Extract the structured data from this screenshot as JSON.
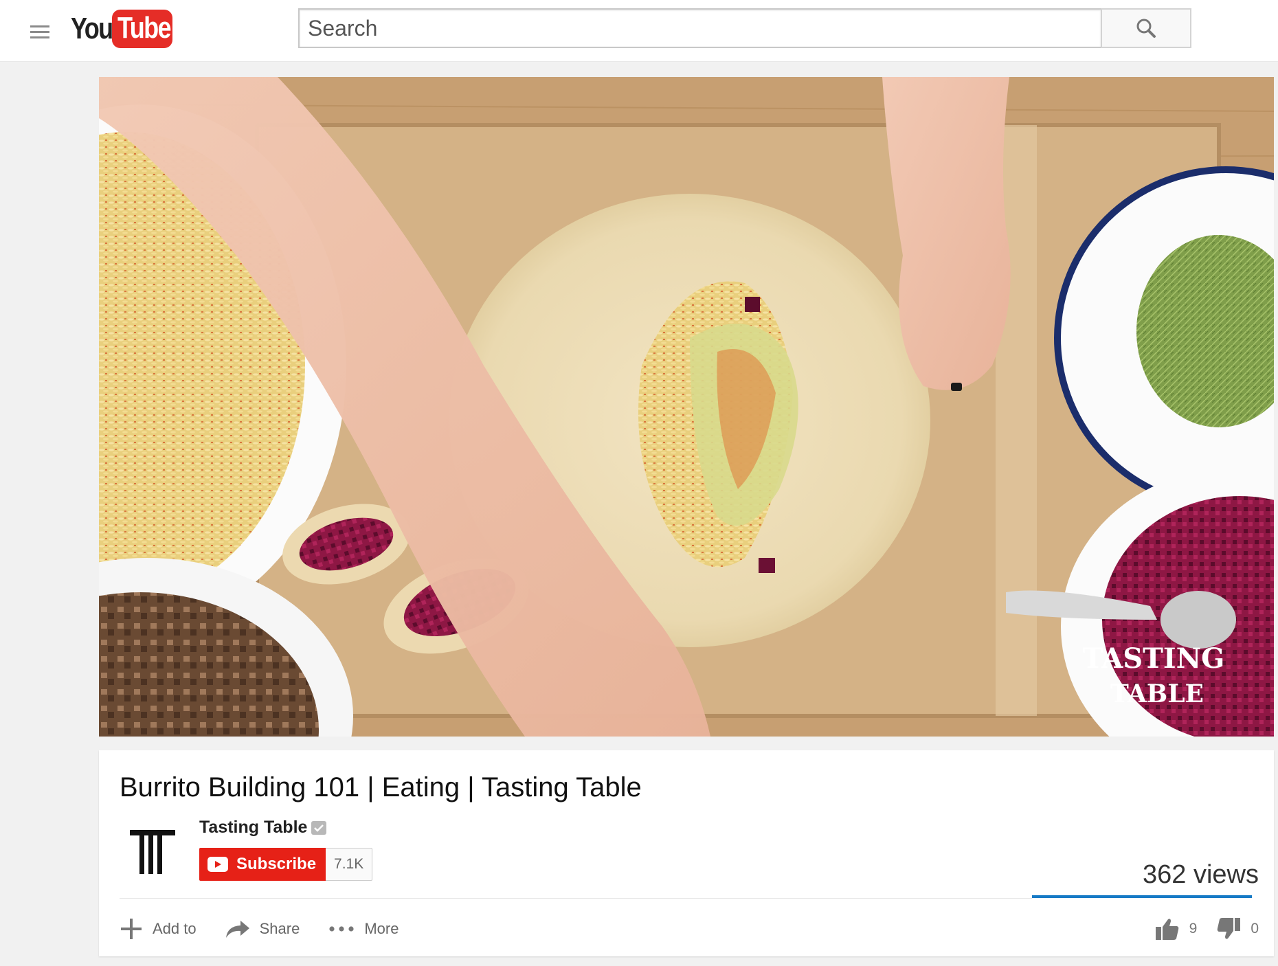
{
  "masthead": {
    "logo_you": "You",
    "logo_tube": "Tube",
    "search_placeholder": "Search"
  },
  "player": {
    "watermark_line1": "TASTING",
    "watermark_line2": "TABLE"
  },
  "video": {
    "title": "Burrito Building 101 | Eating | Tasting Table",
    "channel": "Tasting Table",
    "subscribe_label": "Subscribe",
    "subscriber_count": "7.1K",
    "views": "362 views",
    "like_ratio": 1.0
  },
  "actions": {
    "add_to": "Add to",
    "share": "Share",
    "more": "More",
    "likes": "9",
    "dislikes": "0"
  },
  "colors": {
    "brand_red": "#e62117",
    "sentiment_blue": "#167ac6"
  },
  "icons": [
    "menu-icon",
    "search-icon",
    "verified-icon",
    "play-icon",
    "plus-icon",
    "share-icon",
    "more-icon",
    "thumbs-up-icon",
    "thumbs-down-icon"
  ]
}
